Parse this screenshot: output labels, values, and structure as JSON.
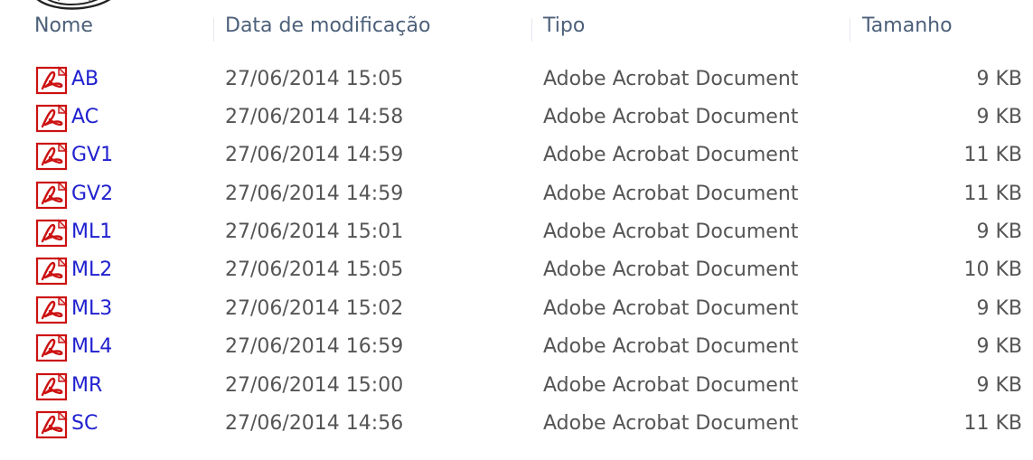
{
  "headers": {
    "name": "Nome",
    "modified": "Data de modificação",
    "type": "Tipo",
    "size": "Tamanho"
  },
  "icon": {
    "file_icon": "pdf-file-icon",
    "sort_icon": "sort-indicator-icon",
    "accent_color": "#cc1111",
    "name_link_color": "#2020d0"
  },
  "files": [
    {
      "name": "AB",
      "modified": "27/06/2014 15:05",
      "type": "Adobe Acrobat Document",
      "size": "9 KB"
    },
    {
      "name": "AC",
      "modified": "27/06/2014 14:58",
      "type": "Adobe Acrobat Document",
      "size": "9 KB"
    },
    {
      "name": "GV1",
      "modified": "27/06/2014 14:59",
      "type": "Adobe Acrobat Document",
      "size": "11 KB"
    },
    {
      "name": "GV2",
      "modified": "27/06/2014 14:59",
      "type": "Adobe Acrobat Document",
      "size": "11 KB"
    },
    {
      "name": "ML1",
      "modified": "27/06/2014 15:01",
      "type": "Adobe Acrobat Document",
      "size": "9 KB"
    },
    {
      "name": "ML2",
      "modified": "27/06/2014 15:05",
      "type": "Adobe Acrobat Document",
      "size": "10 KB"
    },
    {
      "name": "ML3",
      "modified": "27/06/2014 15:02",
      "type": "Adobe Acrobat Document",
      "size": "9 KB"
    },
    {
      "name": "ML4",
      "modified": "27/06/2014 16:59",
      "type": "Adobe Acrobat Document",
      "size": "9 KB"
    },
    {
      "name": "MR",
      "modified": "27/06/2014 15:00",
      "type": "Adobe Acrobat Document",
      "size": "9 KB"
    },
    {
      "name": "SC",
      "modified": "27/06/2014 14:56",
      "type": "Adobe Acrobat Document",
      "size": "11 KB"
    }
  ]
}
